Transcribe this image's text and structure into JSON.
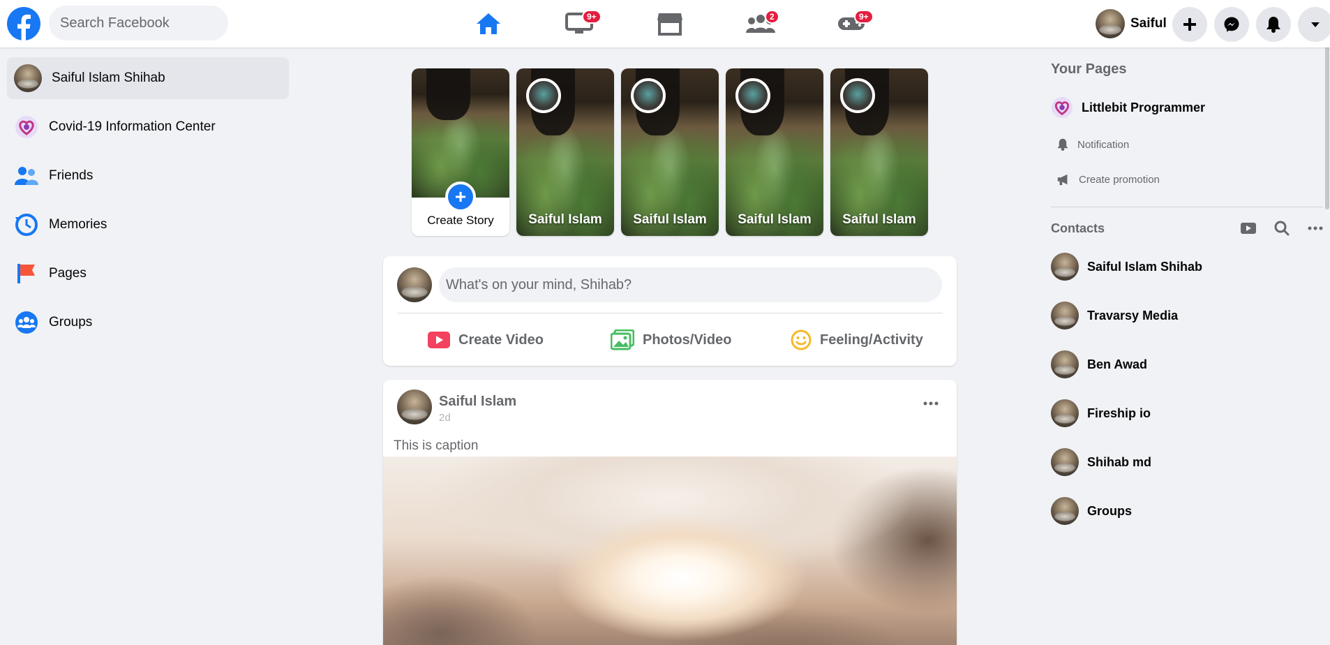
{
  "header": {
    "search_placeholder": "Search Facebook",
    "profile_name": "Saiful",
    "nav": [
      {
        "name": "home",
        "badge": ""
      },
      {
        "name": "watch",
        "badge": "9+"
      },
      {
        "name": "marketplace",
        "badge": ""
      },
      {
        "name": "groups",
        "badge": "2"
      },
      {
        "name": "gaming",
        "badge": "9+"
      }
    ],
    "accent": "#1877f2"
  },
  "sidebar": {
    "items": [
      {
        "label": "Saiful Islam Shihab",
        "icon": "avatar"
      },
      {
        "label": "Covid-19 Information Center",
        "icon": "heart-icon"
      },
      {
        "label": "Friends",
        "icon": "friends-icon"
      },
      {
        "label": "Memories",
        "icon": "memories-icon"
      },
      {
        "label": "Pages",
        "icon": "flag-icon"
      },
      {
        "label": "Groups",
        "icon": "groups-icon"
      }
    ]
  },
  "stories": {
    "create_label": "Create Story",
    "items": [
      "Saiful Islam",
      "Saiful Islam",
      "Saiful Islam",
      "Saiful Islam"
    ]
  },
  "composer": {
    "placeholder": "What's on your mind, Shihab?",
    "actions": [
      {
        "label": "Create Video",
        "icon": "video-icon",
        "color": "#f3425f"
      },
      {
        "label": "Photos/Video",
        "icon": "photos-icon",
        "color": "#45bd62"
      },
      {
        "label": "Feeling/Activity",
        "icon": "smile-icon",
        "color": "#f7b928"
      }
    ]
  },
  "post": {
    "author": "Saiful Islam",
    "time": "2d",
    "caption": "This is caption"
  },
  "right": {
    "pages_heading": "Your Pages",
    "page_name": "Littlebit Programmer",
    "page_actions": [
      {
        "label": "Notification",
        "icon": "bell-icon"
      },
      {
        "label": "Create promotion",
        "icon": "megaphone-icon"
      }
    ],
    "contacts_heading": "Contacts",
    "contacts": [
      "Saiful Islam Shihab",
      "Travarsy Media",
      "Ben Awad",
      "Fireship io",
      "Shihab md",
      "Groups"
    ]
  }
}
